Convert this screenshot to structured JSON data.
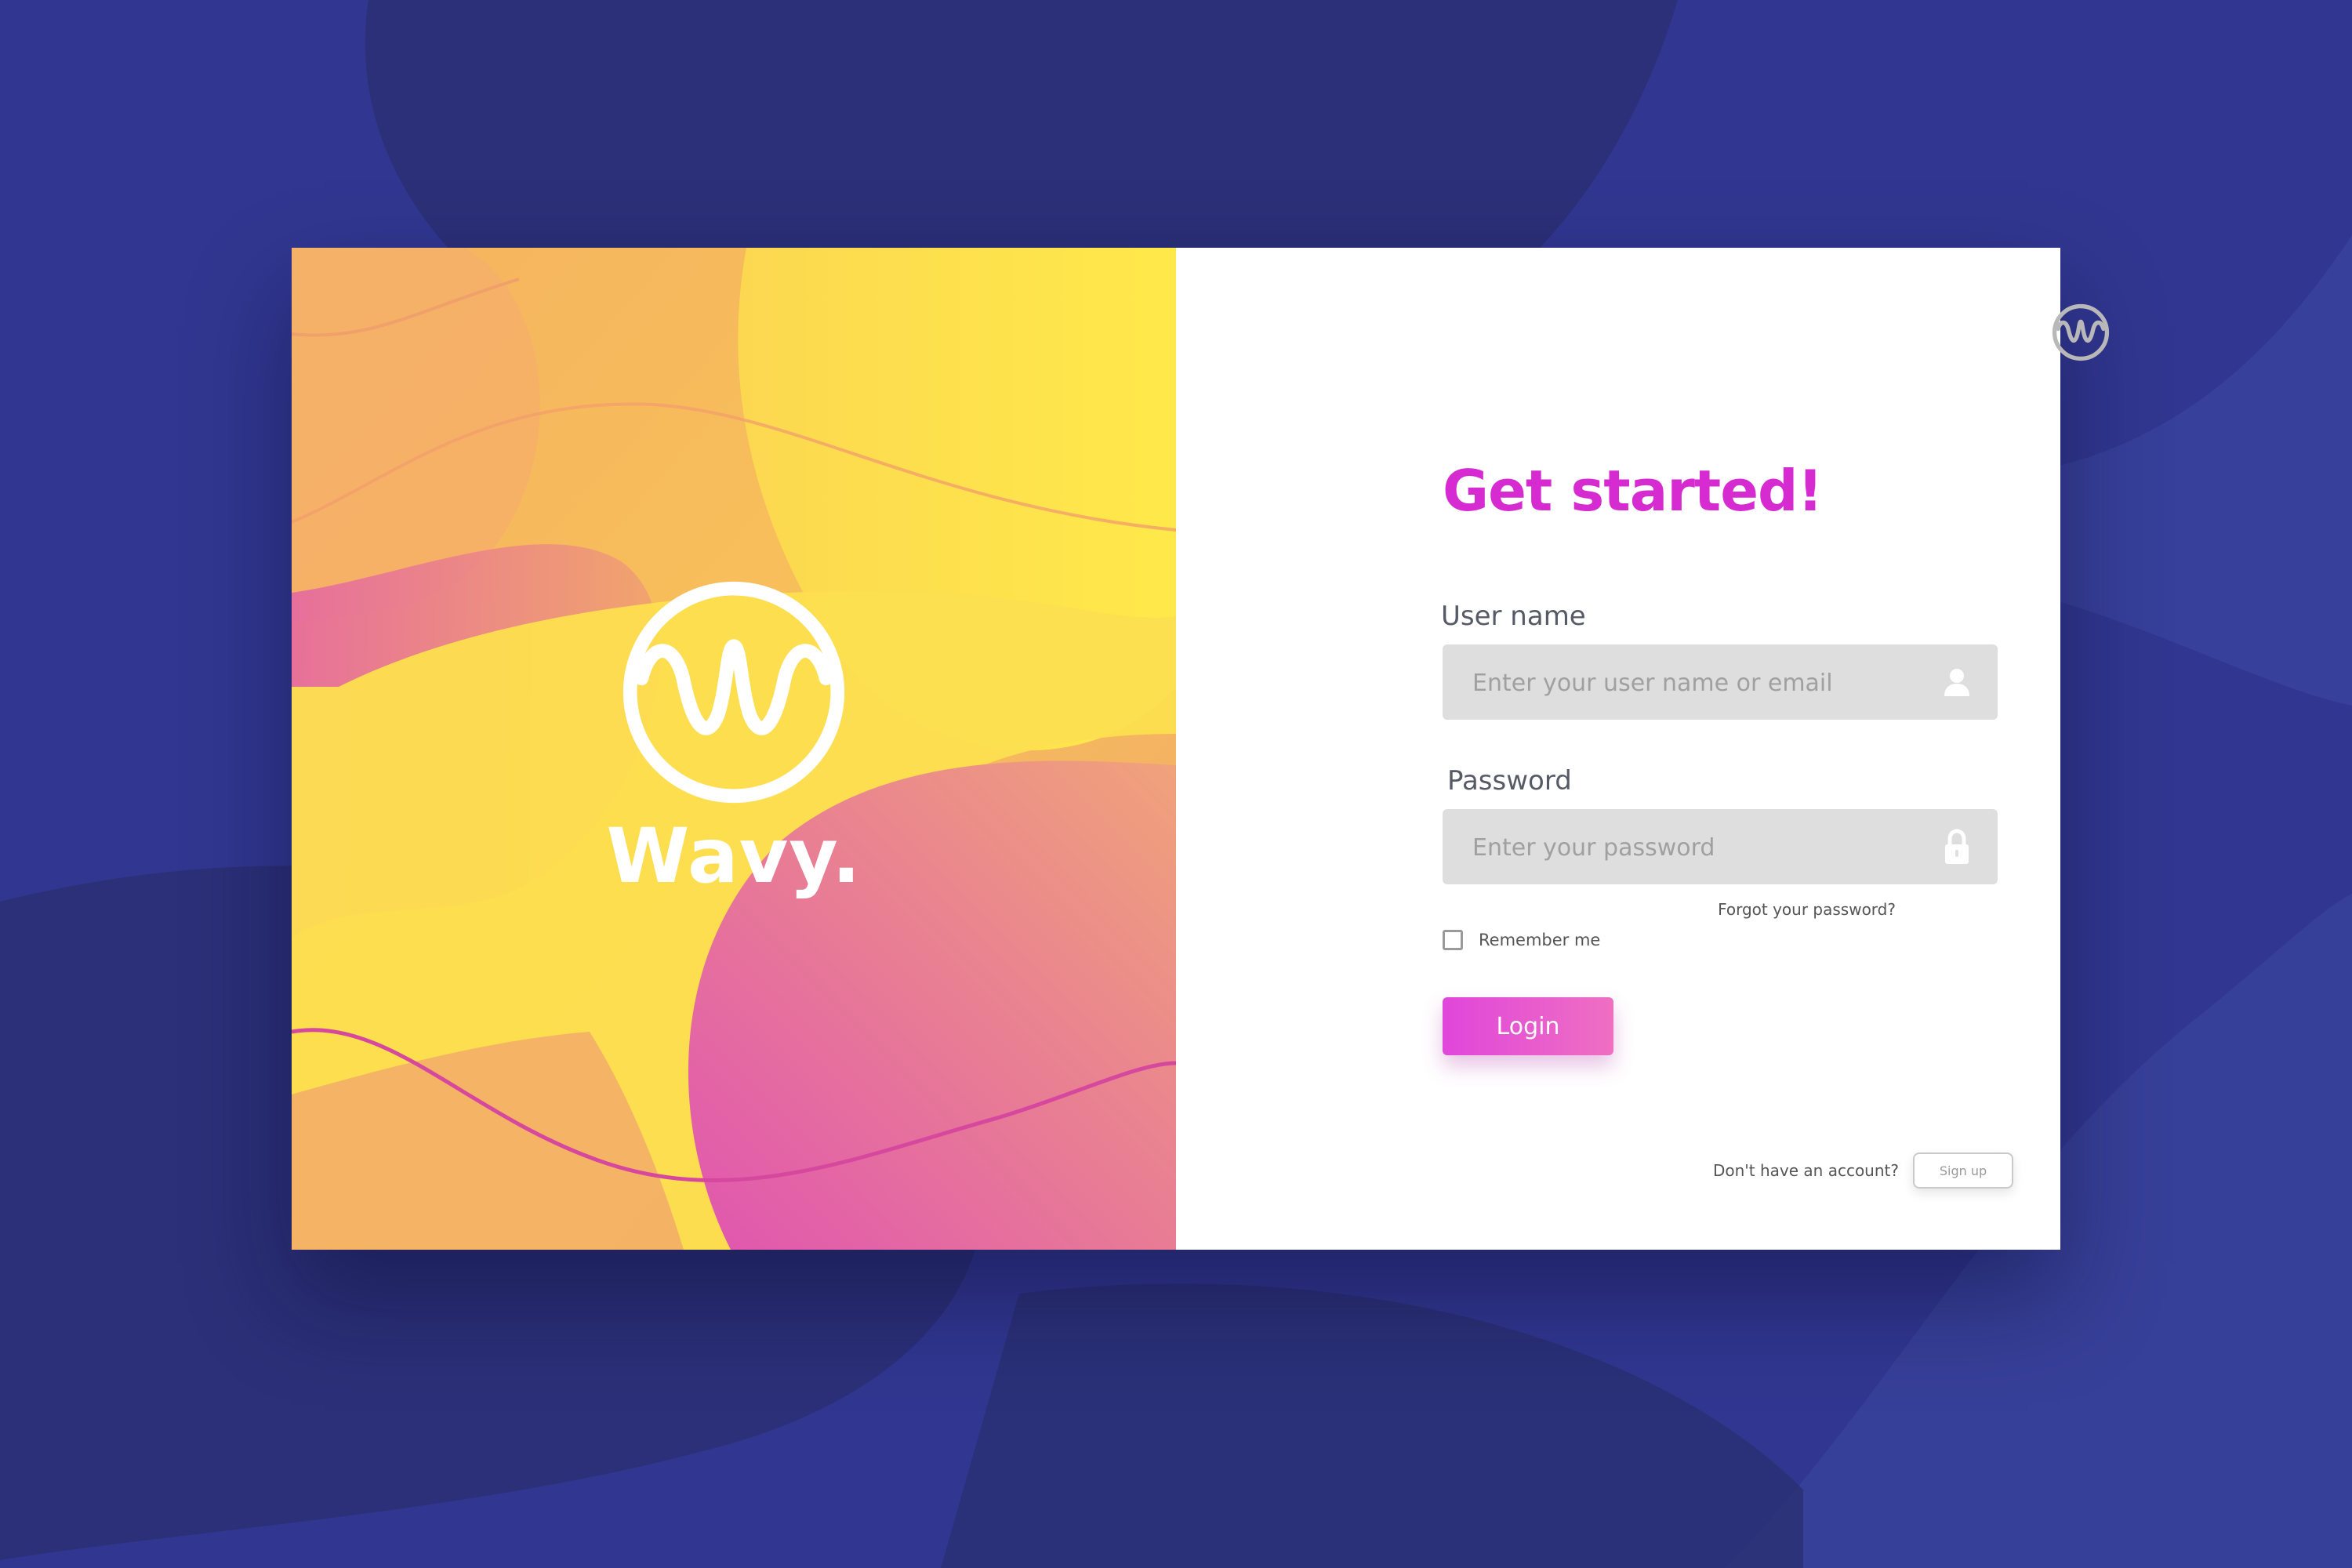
{
  "brand": {
    "name": "Wavy.",
    "logo_icon": "wave-circle-logo"
  },
  "form": {
    "title": "Get started!",
    "username": {
      "label": "User name",
      "placeholder": "Enter your user name or email",
      "icon": "user-icon"
    },
    "password": {
      "label": "Password",
      "placeholder": "Enter your password",
      "icon": "lock-icon"
    },
    "forgot_link": "Forgot your password?",
    "remember_label": "Remember me",
    "remember_checked": false,
    "login_label": "Login",
    "signup_prompt": "Don't have an account?",
    "signup_label": "Sign up"
  },
  "colors": {
    "background": "#2f3584",
    "accent": "#d62bd1",
    "field_bg": "#dedede"
  }
}
